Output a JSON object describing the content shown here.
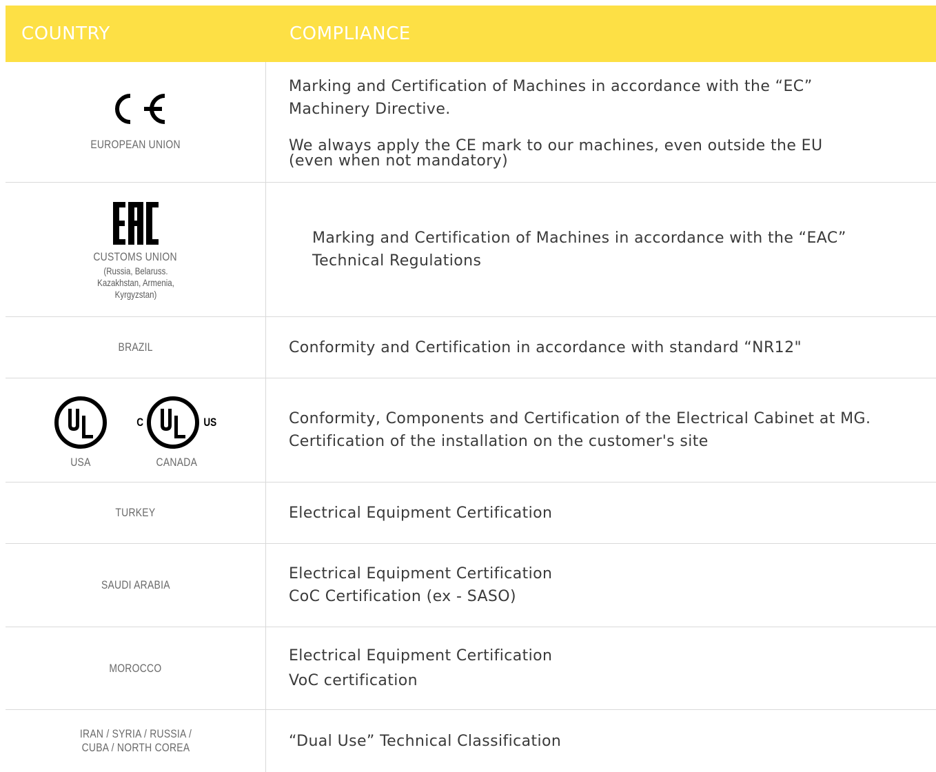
{
  "header": {
    "country": "COUNTRY",
    "compliance": "COMPLIANCE"
  },
  "colors": {
    "header_bg": "#fde045",
    "header_text": "#ffffff",
    "divider": "#d9d9d9"
  },
  "rows": [
    {
      "logo": "ce-mark-icon",
      "logo_text": "CE",
      "country": "EUROPEAN UNION",
      "compliance": [
        "Marking and Certification of Machines in accordance with the “EC” Machinery Directive.",
        "We always apply the CE mark to our machines, even outside the EU (even when not mandatory)"
      ]
    },
    {
      "logo": "eac-mark-icon",
      "logo_text": "EAC",
      "country": "CUSTOMS UNION",
      "country_sub": "(Russia, Belaruss. Kazakhstan, Armenia, Kyrgyzstan)",
      "compliance": [
        "Marking and Certification of Machines in accordance with the “EAC” Technical Regulations"
      ]
    },
    {
      "country": "BRAZIL",
      "compliance": [
        "Conformity and Certification in accordance with standard “NR12\""
      ]
    },
    {
      "logo": "ul-mark-icon",
      "logo_text": "UL",
      "countries": [
        "USA",
        "CANADA"
      ],
      "ul_prefix": "C",
      "ul_suffix": "US",
      "compliance": [
        "Conformity, Components and Certification of the Electrical Cabinet at MG.",
        "Certification of the installation on the customer's site"
      ]
    },
    {
      "country": "TURKEY",
      "compliance": [
        "Electrical Equipment Certification"
      ]
    },
    {
      "country": "SAUDI ARABIA",
      "compliance": [
        "Electrical Equipment Certification",
        "CoC Certification (ex - SASO)"
      ]
    },
    {
      "country": "MOROCCO",
      "compliance": [
        "Electrical Equipment Certification",
        "VoC certification"
      ]
    },
    {
      "country": "IRAN / SYRIA / RUSSIA / CUBA / NORTH COREA",
      "compliance": [
        "“Dual Use” Technical Classification"
      ]
    }
  ]
}
